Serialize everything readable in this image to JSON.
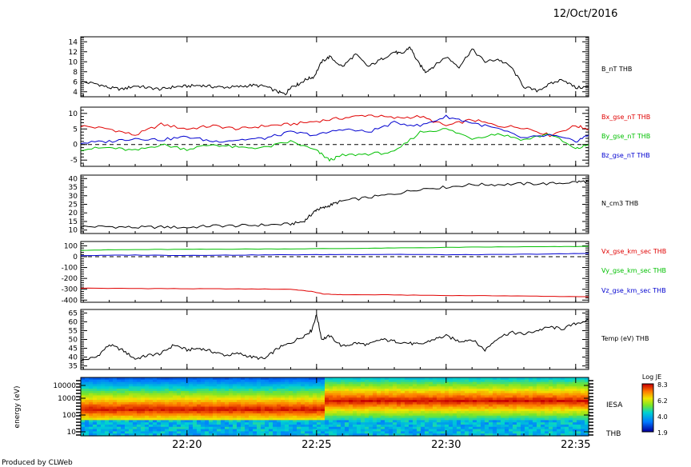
{
  "header": {
    "date": "12/Oct/2016"
  },
  "footer": {
    "credit": "Produced by CLWeb"
  },
  "colors": {
    "red": "#e00000",
    "green": "#00c000",
    "blue": "#0000d0",
    "black": "#000000"
  },
  "time_axis": {
    "ticks": [
      "22:20",
      "22:25",
      "22:30",
      "22:35"
    ],
    "tick_minutes": [
      20,
      25,
      30,
      35
    ],
    "range_minutes": [
      15.9,
      35.5
    ]
  },
  "chart_data": [
    {
      "type": "line",
      "id": "b",
      "ylim": [
        3,
        15
      ],
      "yticks": [
        4,
        6,
        8,
        10,
        12,
        14
      ],
      "series": [
        {
          "name": "B_nT THB",
          "color": "#000000",
          "x": [
            15.9,
            16.5,
            17.0,
            17.5,
            18.0,
            18.5,
            19.0,
            19.5,
            20.0,
            20.5,
            21.0,
            21.5,
            22.0,
            22.5,
            23.0,
            23.5,
            23.8,
            24.0,
            24.3,
            24.6,
            24.9,
            25.2,
            25.5,
            26.0,
            26.5,
            27.0,
            27.5,
            28.0,
            28.3,
            28.6,
            28.9,
            29.2,
            29.5,
            30.0,
            30.5,
            31.0,
            31.5,
            32.0,
            32.5,
            33.0,
            33.5,
            34.0,
            34.5,
            35.0,
            35.5
          ],
          "y": [
            6.0,
            5.6,
            4.8,
            4.5,
            5.2,
            4.8,
            4.5,
            5.0,
            5.1,
            5.3,
            5.0,
            4.9,
            5.0,
            5.3,
            5.1,
            4.0,
            3.5,
            5.0,
            5.5,
            6.5,
            7.0,
            10.0,
            11.0,
            9.0,
            11.5,
            9.0,
            10.5,
            12.0,
            11.5,
            13.0,
            10.0,
            8.0,
            9.0,
            11.0,
            9.0,
            12.5,
            10.0,
            10.5,
            9.0,
            5.0,
            4.2,
            5.5,
            6.5,
            4.8,
            5.0
          ]
        }
      ]
    },
    {
      "type": "line",
      "id": "bgse",
      "ylim": [
        -7,
        12
      ],
      "yticks": [
        -5,
        0,
        5,
        10
      ],
      "zero_line": true,
      "series": [
        {
          "name": "Bx_gse_nT THB",
          "color": "#e00000",
          "x": [
            15.9,
            17,
            18,
            19,
            20,
            21,
            22,
            23,
            24,
            25,
            26,
            27,
            28,
            29,
            30,
            31,
            32,
            33,
            34,
            35,
            35.5
          ],
          "y": [
            6.0,
            5.0,
            3.0,
            6.5,
            5.0,
            6.0,
            5.0,
            6.0,
            6.5,
            7.5,
            8.5,
            9.5,
            8.5,
            9.0,
            6.0,
            8.0,
            6.0,
            5.5,
            3.0,
            6.0,
            5.0
          ]
        },
        {
          "name": "By_gse_nT THB",
          "color": "#00c000",
          "x": [
            15.9,
            17,
            18,
            19,
            20,
            21,
            22,
            23,
            24,
            25,
            25.5,
            26,
            27,
            28,
            29,
            30,
            31,
            32,
            33,
            34,
            35,
            35.5
          ],
          "y": [
            -1.5,
            -1.0,
            -2.0,
            0.0,
            -1.5,
            0.0,
            -1.0,
            -1.0,
            1.0,
            -2.0,
            -5.0,
            -3.5,
            -3.0,
            -2.5,
            4.0,
            5.0,
            2.0,
            3.5,
            1.5,
            3.5,
            -1.5,
            0.0
          ]
        },
        {
          "name": "Bz_gse_nT THB",
          "color": "#0000d0",
          "x": [
            15.9,
            17,
            18,
            19,
            20,
            21,
            22,
            23,
            24,
            25,
            26,
            27,
            28,
            29,
            30,
            31,
            32,
            33,
            34,
            35,
            35.5
          ],
          "y": [
            0.5,
            1.0,
            2.0,
            1.5,
            2.5,
            1.0,
            1.5,
            2.0,
            4.0,
            3.0,
            5.0,
            4.0,
            7.0,
            6.0,
            9.0,
            7.0,
            5.0,
            2.0,
            3.0,
            1.0,
            3.0
          ]
        }
      ]
    },
    {
      "type": "line",
      "id": "n",
      "ylim": [
        8,
        42
      ],
      "yticks": [
        10,
        15,
        20,
        25,
        30,
        35,
        40
      ],
      "series": [
        {
          "name": "N_cm3 THB",
          "color": "#000000",
          "x": [
            15.9,
            17,
            18,
            19,
            20,
            21,
            22,
            23,
            24,
            24.5,
            24.8,
            25.0,
            25.3,
            25.6,
            26,
            27,
            28,
            29,
            30,
            31,
            32,
            33,
            34,
            35,
            35.5
          ],
          "y": [
            12.0,
            12.0,
            11.5,
            11.8,
            11.5,
            12.5,
            12.5,
            13.0,
            13.5,
            15.0,
            19.0,
            22.0,
            23.0,
            25.0,
            27.0,
            29.0,
            31.0,
            34.0,
            35.0,
            36.5,
            36.5,
            37.0,
            37.0,
            38.0,
            38.5
          ]
        }
      ]
    },
    {
      "type": "line",
      "id": "v",
      "ylim": [
        -420,
        140
      ],
      "yticks": [
        -400,
        -300,
        -200,
        -100,
        0,
        100
      ],
      "zero_line": true,
      "series": [
        {
          "name": "Vx_gse_km_sec THB",
          "color": "#e00000",
          "x": [
            15.9,
            18,
            20,
            22,
            24,
            24.8,
            25.3,
            26,
            28,
            30,
            32,
            34,
            35.5
          ],
          "y": [
            -290,
            -293,
            -295,
            -297,
            -300,
            -320,
            -345,
            -350,
            -352,
            -358,
            -360,
            -365,
            -370
          ]
        },
        {
          "name": "Vy_gse_km_sec THB",
          "color": "#00c000",
          "x": [
            15.9,
            18,
            20,
            22,
            24,
            26,
            28,
            30,
            32,
            34,
            35.5
          ],
          "y": [
            60,
            65,
            68,
            70,
            72,
            75,
            80,
            85,
            90,
            92,
            95
          ]
        },
        {
          "name": "Vz_gse_km_sec THB",
          "color": "#0000d0",
          "x": [
            15.9,
            18,
            20,
            22,
            24,
            26,
            28,
            30,
            32,
            34,
            35.5
          ],
          "y": [
            10,
            15,
            12,
            15,
            18,
            20,
            22,
            18,
            20,
            25,
            30
          ]
        }
      ]
    },
    {
      "type": "line",
      "id": "temp",
      "ylim": [
        33,
        67
      ],
      "yticks": [
        35,
        40,
        45,
        50,
        55,
        60,
        65
      ],
      "series": [
        {
          "name": "Temp (eV) THB",
          "color": "#000000",
          "x": [
            15.9,
            16.5,
            17,
            17.5,
            18,
            18.5,
            19,
            19.5,
            20,
            20.5,
            21,
            21.5,
            22,
            22.5,
            23,
            23.5,
            24,
            24.5,
            24.8,
            25.0,
            25.2,
            25.5,
            26,
            26.5,
            27,
            27.5,
            28,
            28.5,
            29,
            29.5,
            30,
            30.5,
            31,
            31.5,
            32,
            32.5,
            33,
            33.5,
            34,
            34.5,
            35,
            35.5
          ],
          "y": [
            38,
            40,
            47,
            44,
            39,
            41,
            42,
            47,
            44,
            45,
            43,
            41,
            42,
            40,
            39,
            45,
            48,
            52,
            55,
            64,
            50,
            52,
            46,
            48,
            47,
            50,
            49,
            48,
            47,
            50,
            52,
            49,
            50,
            44,
            51,
            54,
            53,
            55,
            57,
            56,
            59,
            61
          ]
        }
      ]
    },
    {
      "type": "heatmap",
      "id": "iesa",
      "ylabel": "energy (eV)",
      "name": "IESA",
      "sublabel": "THB",
      "yticks": [
        "10",
        "100",
        "1000",
        "10000"
      ],
      "colorbar": {
        "title": "Log JE",
        "ticks": [
          "8.3",
          "6.2",
          "4.0",
          "1.9"
        ]
      }
    }
  ]
}
